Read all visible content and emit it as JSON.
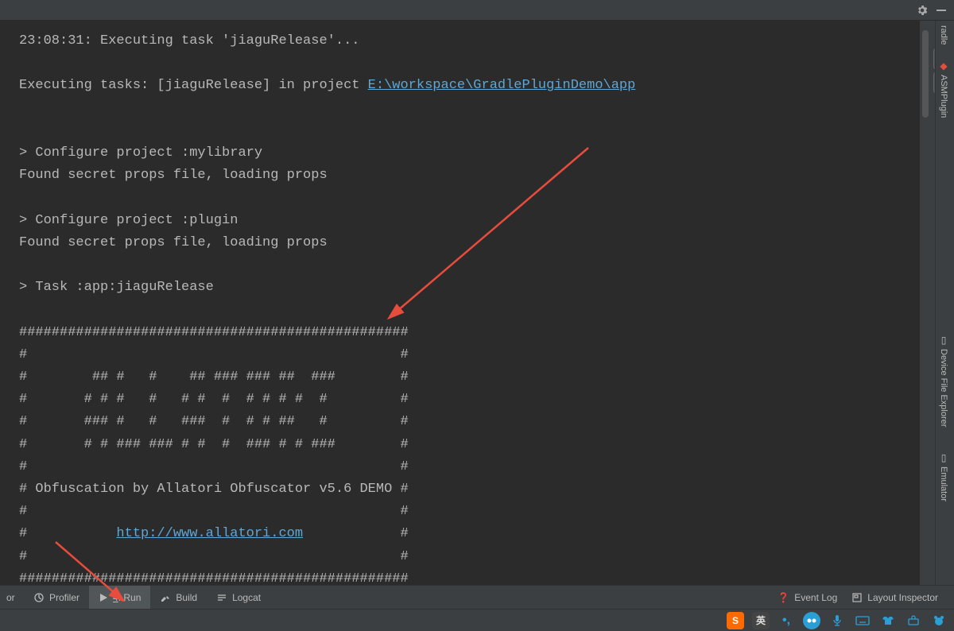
{
  "topbar": {},
  "console": {
    "l1": "23:08:31: Executing task 'jiaguRelease'...",
    "l2": "",
    "l3a": "Executing tasks: [jiaguRelease] in project ",
    "l3link": "E:\\workspace\\GradlePluginDemo\\app",
    "l4": "",
    "l5": "",
    "l6": "> Configure project :mylibrary",
    "l7": "Found secret props file, loading props",
    "l8": "",
    "l9": "> Configure project :plugin",
    "l10": "Found secret props file, loading props",
    "l11": "",
    "l12": "> Task :app:jiaguRelease",
    "l13": "",
    "l14": "################################################",
    "l15": "#                                              #",
    "l16": "#        ## #   #    ## ### ### ##  ###        #",
    "l17": "#       # # #   #   # #  #  # # # #  #         #",
    "l18": "#       ### #   #   ###  #  # # ##   #         #",
    "l19": "#       # # ### ### # #  #  ### # # ###        #",
    "l20": "#                                              #",
    "l21": "# Obfuscation by Allatori Obfuscator v5.6 DEMO #",
    "l22": "#                                              #",
    "l23a": "#           ",
    "l23link": "http://www.allatori.com",
    "l23b": "            #",
    "l24": "#                                              #",
    "l25": "################################################"
  },
  "rightTabs": {
    "t1": "radle",
    "t2": "ASMPlugin",
    "t3": "Device File Explorer",
    "t4": "Emulator"
  },
  "bottom": {
    "profiler": "Profiler",
    "run_prefix": "4",
    "run_label": ": Run",
    "build": "Build",
    "logcat": "Logcat",
    "eventlog": "Event Log",
    "layout": "Layout Inspector"
  },
  "tray": {
    "ime1": "S",
    "ime2": "英"
  }
}
